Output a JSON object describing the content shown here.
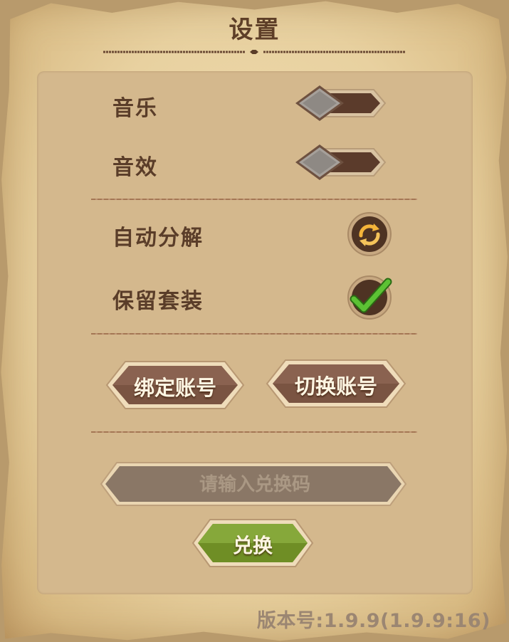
{
  "dialog": {
    "title": "设置"
  },
  "settings": {
    "music": {
      "label": "音乐",
      "enabled": false
    },
    "sound_effects": {
      "label": "音效",
      "enabled": false
    },
    "auto_decompose": {
      "label": "自动分解",
      "icon": "refresh-arrows-icon"
    },
    "keep_sets": {
      "label": "保留套装",
      "checked": true,
      "icon": "checkmark-icon"
    }
  },
  "account": {
    "bind_label": "绑定账号",
    "switch_label": "切换账号"
  },
  "redeem": {
    "placeholder": "请输入兑换码",
    "value": "",
    "button_label": "兑换"
  },
  "footer": {
    "version_text": "版本号:1.9.9(1.9.9:16)"
  },
  "colors": {
    "parchment": "#e8d1a0",
    "panel": "#d4b88d",
    "text_brown": "#5a3d29",
    "button_brown": "#7a5442",
    "button_green": "#7fa030",
    "check_green": "#4cae2c"
  }
}
